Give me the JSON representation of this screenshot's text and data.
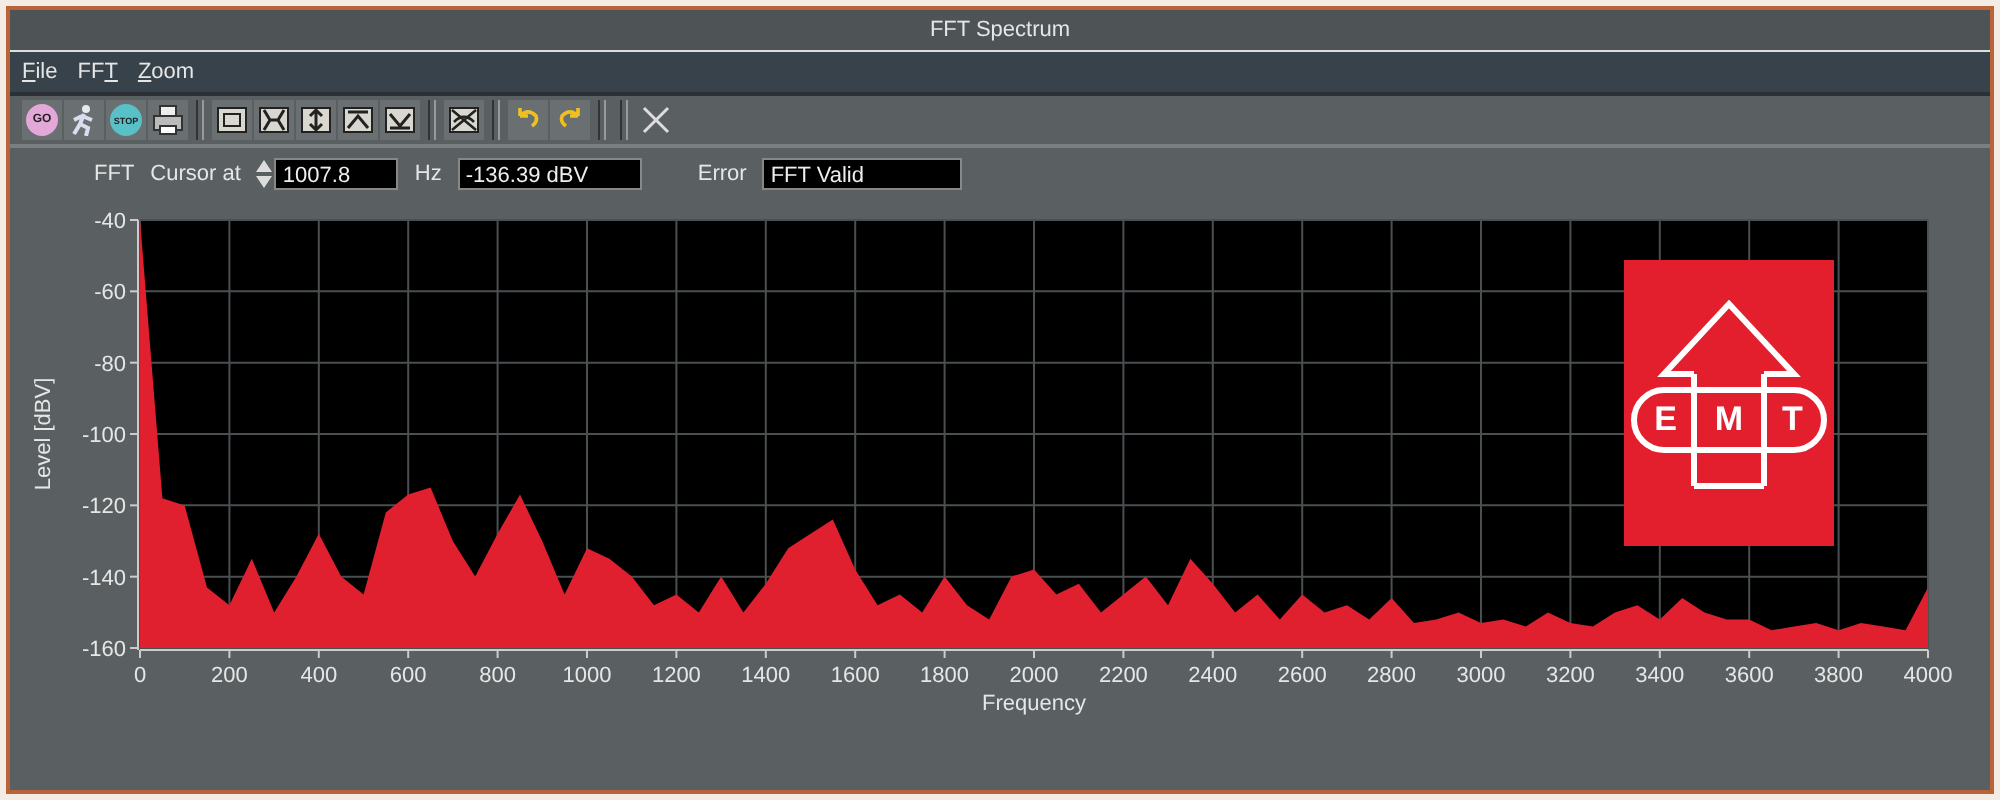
{
  "window": {
    "title": "FFT Spectrum"
  },
  "menus": [
    {
      "key": "F",
      "after": "ile"
    },
    {
      "before": "FF",
      "key": "T"
    },
    {
      "key": "Z",
      "after": "oom"
    }
  ],
  "toolbar": [
    {
      "kind": "go",
      "label": "GO"
    },
    {
      "kind": "run"
    },
    {
      "kind": "stop",
      "label": "STOP"
    },
    {
      "kind": "print"
    },
    {
      "kind": "separator"
    },
    {
      "kind": "zoom-box"
    },
    {
      "kind": "zoom-x"
    },
    {
      "kind": "zoom-y"
    },
    {
      "kind": "zoom-up"
    },
    {
      "kind": "zoom-down"
    },
    {
      "kind": "separator"
    },
    {
      "kind": "zoom-fit"
    },
    {
      "kind": "separator"
    },
    {
      "kind": "undo"
    },
    {
      "kind": "redo"
    },
    {
      "kind": "separator"
    },
    {
      "kind": "separator"
    },
    {
      "kind": "close"
    }
  ],
  "cursor": {
    "mode": "FFT",
    "label": "Cursor at",
    "frequency": "1007.8",
    "unit": "Hz",
    "level": "-136.39 dBV",
    "error_label": "Error",
    "error": "FFT Valid"
  },
  "logo": {
    "letters": [
      "E",
      "M",
      "T"
    ]
  },
  "chart_data": {
    "type": "area",
    "grid": true,
    "xlabel": "Frequency",
    "ylabel": "Level [dBV]",
    "xlim": [
      0,
      4000
    ],
    "ylim": [
      -160,
      -40
    ],
    "xticks": [
      0,
      200,
      400,
      600,
      800,
      1000,
      1200,
      1400,
      1600,
      1800,
      2000,
      2200,
      2400,
      2600,
      2800,
      3000,
      3200,
      3400,
      3600,
      3800,
      4000
    ],
    "yticks": [
      -40,
      -60,
      -80,
      -100,
      -120,
      -140,
      -160
    ],
    "x": [
      0,
      50,
      100,
      150,
      200,
      250,
      300,
      350,
      400,
      450,
      500,
      550,
      600,
      650,
      700,
      750,
      800,
      850,
      900,
      950,
      1000,
      1050,
      1100,
      1150,
      1200,
      1250,
      1300,
      1350,
      1400,
      1450,
      1500,
      1550,
      1600,
      1650,
      1700,
      1750,
      1800,
      1850,
      1900,
      1950,
      2000,
      2050,
      2100,
      2150,
      2200,
      2250,
      2300,
      2350,
      2400,
      2450,
      2500,
      2550,
      2600,
      2650,
      2700,
      2750,
      2800,
      2850,
      2900,
      2950,
      3000,
      3050,
      3100,
      3150,
      3200,
      3250,
      3300,
      3350,
      3400,
      3450,
      3500,
      3550,
      3600,
      3650,
      3700,
      3750,
      3800,
      3850,
      3900,
      3950,
      4000
    ],
    "series": [
      {
        "color": "#e0202e",
        "values": [
          -40,
          -118,
          -120,
          -143,
          -148,
          -135,
          -150,
          -140,
          -128,
          -140,
          -145,
          -122,
          -117,
          -115,
          -130,
          -140,
          -128,
          -117,
          -130,
          -145,
          -132,
          -135,
          -140,
          -148,
          -145,
          -150,
          -140,
          -150,
          -142,
          -132,
          -128,
          -124,
          -138,
          -148,
          -145,
          -150,
          -140,
          -148,
          -152,
          -140,
          -138,
          -145,
          -142,
          -150,
          -145,
          -140,
          -148,
          -135,
          -142,
          -150,
          -145,
          -152,
          -145,
          -150,
          -148,
          -152,
          -146,
          -153,
          -152,
          -150,
          -153,
          -152,
          -154,
          -150,
          -153,
          -154,
          -150,
          -148,
          -152,
          -146,
          -150,
          -152,
          -152,
          -155,
          -154,
          -153,
          -155,
          -153,
          -154,
          -155,
          -143
        ]
      }
    ]
  }
}
